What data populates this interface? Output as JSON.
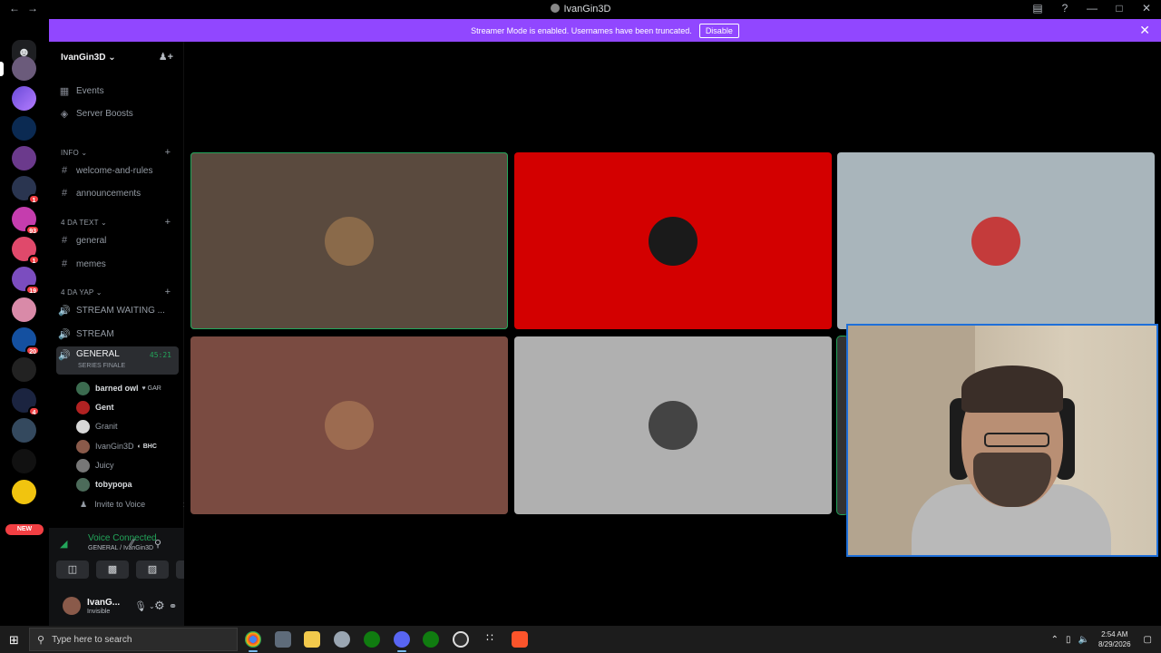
{
  "window": {
    "title": "IvanGin3D"
  },
  "banner": {
    "text": "Streamer Mode is enabled. Usernames have been truncated.",
    "button": "Disable"
  },
  "guild_badges": [
    "1",
    "1",
    "93",
    "1",
    "19",
    "20",
    "4"
  ],
  "guild_new": "NEW",
  "server": {
    "name": "IvanGin3D"
  },
  "sidebar": {
    "events": "Events",
    "boosts": "Server Boosts",
    "categories": [
      {
        "name": "INFO",
        "channels": [
          "welcome-and-rules",
          "announcements"
        ]
      },
      {
        "name": "4 DA TEXT",
        "channels": [
          "general",
          "memes"
        ]
      },
      {
        "name": "4 DA YAP",
        "channels": [
          "STREAM WAITING ...",
          "STREAM"
        ]
      }
    ],
    "active_voice": {
      "name": "GENERAL",
      "timer": "45:21",
      "subtitle": "SERIES FINALE"
    },
    "voice_users": [
      {
        "name": "barned owl",
        "tag": "GAR",
        "color": "#3b6b4f"
      },
      {
        "name": "Gent",
        "tag": "",
        "color": "#b22222"
      },
      {
        "name": "Granit",
        "tag": "",
        "color": "#d8d8d8"
      },
      {
        "name": "IvanGin3D",
        "tag": "BHC",
        "color": "#8a5a4a"
      },
      {
        "name": "Juicy",
        "tag": "",
        "color": "#777777"
      },
      {
        "name": "tobypopa",
        "tag": "",
        "color": "#4c6b5a"
      }
    ],
    "invite": "Invite to Voice"
  },
  "voice_panel": {
    "status": "Voice Connected",
    "channel": "GENERAL / IvanGin3D"
  },
  "user_panel": {
    "name": "IvanG...",
    "status": "Invisible"
  },
  "tiles": [
    {
      "bg": "#5a4a3e",
      "avatar": "#8a6a4a",
      "speaking": true
    },
    {
      "bg": "#d30000",
      "avatar": "#1a1a1a",
      "speaking": false
    },
    {
      "bg": "#a9b5bb",
      "avatar": "#c43b3b",
      "speaking": false
    },
    {
      "bg": "#7a4b41",
      "avatar": "#9c6b50",
      "speaking": false
    },
    {
      "bg": "#b0b0b0",
      "avatar": "#444444",
      "speaking": false
    }
  ],
  "taskbar": {
    "search_placeholder": "Type here to search",
    "time": "2:54 AM",
    "date": "8/29/2026"
  }
}
